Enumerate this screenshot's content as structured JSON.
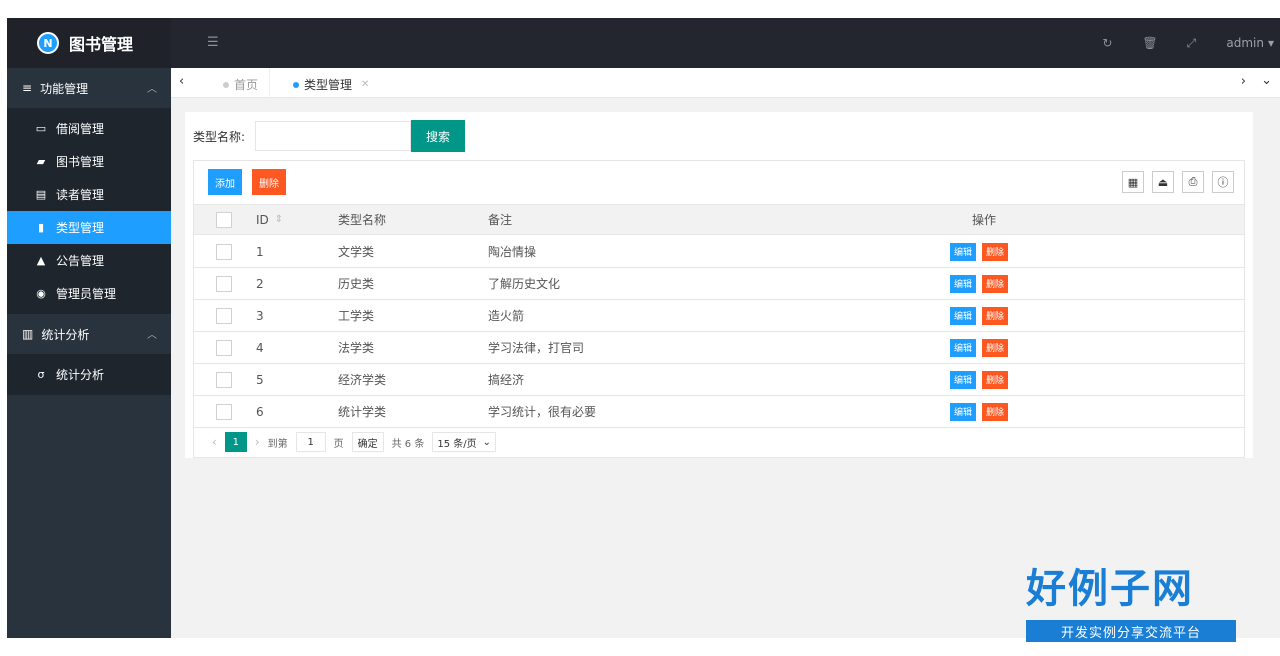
{
  "app": {
    "title": "图书管理"
  },
  "header": {
    "user": "admin"
  },
  "sidebar": {
    "groups": [
      {
        "label": "功能管理",
        "items": [
          {
            "label": "借阅管理",
            "icon": "book-open-icon"
          },
          {
            "label": "图书管理",
            "icon": "book-icon"
          },
          {
            "label": "读者管理",
            "icon": "card-icon"
          },
          {
            "label": "类型管理",
            "icon": "file-icon"
          },
          {
            "label": "公告管理",
            "icon": "bell-icon"
          },
          {
            "label": "管理员管理",
            "icon": "user-circle-icon"
          }
        ]
      },
      {
        "label": "统计分析",
        "items": [
          {
            "label": "统计分析",
            "icon": "chart-curve-icon"
          }
        ]
      }
    ]
  },
  "tabs": {
    "home": "首页",
    "current": "类型管理"
  },
  "search": {
    "label": "类型名称:",
    "value": "",
    "button": "搜索"
  },
  "toolbar": {
    "add": "添加",
    "delete": "删除"
  },
  "table": {
    "columns": {
      "id": "ID",
      "name": "类型名称",
      "note": "备注",
      "op": "操作"
    },
    "rows": [
      {
        "id": "1",
        "name": "文学类",
        "note": "陶冶情操"
      },
      {
        "id": "2",
        "name": "历史类",
        "note": "了解历史文化"
      },
      {
        "id": "3",
        "name": "工学类",
        "note": "造火箭"
      },
      {
        "id": "4",
        "name": "法学类",
        "note": "学习法律，打官司"
      },
      {
        "id": "5",
        "name": "经济学类",
        "note": "搞经济"
      },
      {
        "id": "6",
        "name": "统计学类",
        "note": "学习统计，很有必要"
      }
    ],
    "edit": "编辑",
    "remove": "删除"
  },
  "pager": {
    "current": "1",
    "goto": "到第",
    "page_input": "1",
    "page_unit": "页",
    "confirm": "确定",
    "total": "共 6 条",
    "size": "15 条/页"
  },
  "brand": {
    "big": "好例子网",
    "small": "开发实例分享交流平台"
  }
}
